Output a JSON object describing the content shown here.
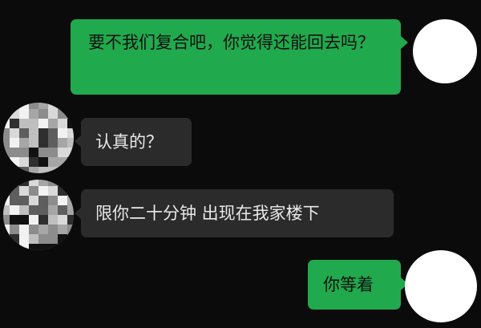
{
  "messages": [
    {
      "side": "sent",
      "text": "要不我们复合吧，你觉得还能回去吗？"
    },
    {
      "side": "recv",
      "text": "认真的？"
    },
    {
      "side": "recv",
      "text": "限你二十分钟 出现在我家楼下"
    },
    {
      "side": "sent",
      "text": "你等着"
    }
  ],
  "colors": {
    "background": "#0b0b0b",
    "sent_bubble": "#21a94d",
    "recv_bubble": "#2b2b2b"
  },
  "icons": {
    "own_avatar": "blank-avatar-icon",
    "contact_avatar": "pixelated-avatar-icon"
  }
}
